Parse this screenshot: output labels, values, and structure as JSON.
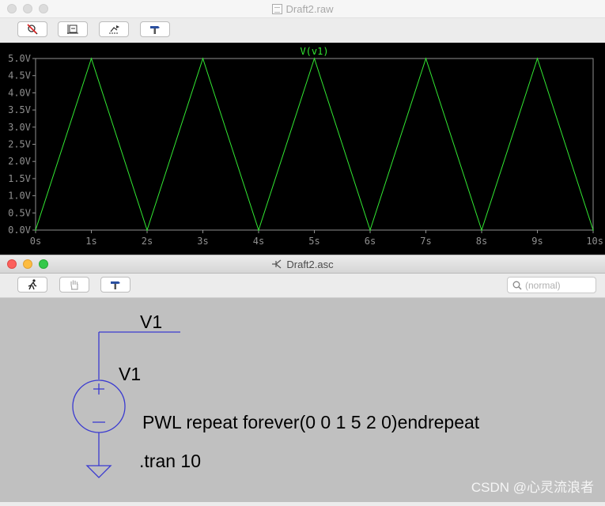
{
  "waveform_window": {
    "title": "Draft2.raw",
    "toolbar": [
      {
        "name": "zoom-cancel-button",
        "icon": "zoom-cancel-icon"
      },
      {
        "name": "autorange-button",
        "icon": "autorange-icon"
      },
      {
        "name": "pan-button",
        "icon": "pan-icon"
      },
      {
        "name": "hammer-button",
        "icon": "hammer-icon"
      }
    ],
    "trace_label": "V(v1)"
  },
  "schematic_window": {
    "title": "Draft2.asc",
    "toolbar": [
      {
        "name": "run-button",
        "icon": "running-man-icon"
      },
      {
        "name": "halt-button",
        "icon": "hand-icon"
      },
      {
        "name": "hammer-button",
        "icon": "hammer-icon"
      }
    ],
    "search_placeholder": "(normal)",
    "net_label": "V1",
    "source_name": "V1",
    "source_value": "PWL repeat forever(0 0 1 5 2 0)endrepeat",
    "directive": ".tran 10"
  },
  "watermark": "CSDN @心灵流浪者",
  "colors": {
    "trace": "#32e832",
    "grid": "#909090",
    "plot_bg": "#000000",
    "wire": "#3a3ad0",
    "schematic_bg": "#c0c0c0"
  },
  "chart_data": {
    "type": "line",
    "title": "V(v1)",
    "series": [
      {
        "name": "V(v1)",
        "x": [
          0,
          1,
          2,
          3,
          4,
          5,
          6,
          7,
          8,
          9,
          10
        ],
        "y": [
          0,
          5,
          0,
          5,
          0,
          5,
          0,
          5,
          0,
          5,
          0
        ]
      }
    ],
    "xlim": [
      0,
      10
    ],
    "ylim": [
      0,
      5
    ],
    "x_ticks": [
      "0s",
      "1s",
      "2s",
      "3s",
      "4s",
      "5s",
      "6s",
      "7s",
      "8s",
      "9s",
      "10s"
    ],
    "y_ticks": [
      "0.0V",
      "0.5V",
      "1.0V",
      "1.5V",
      "2.0V",
      "2.5V",
      "3.0V",
      "3.5V",
      "4.0V",
      "4.5V",
      "5.0V"
    ],
    "grid": false
  }
}
